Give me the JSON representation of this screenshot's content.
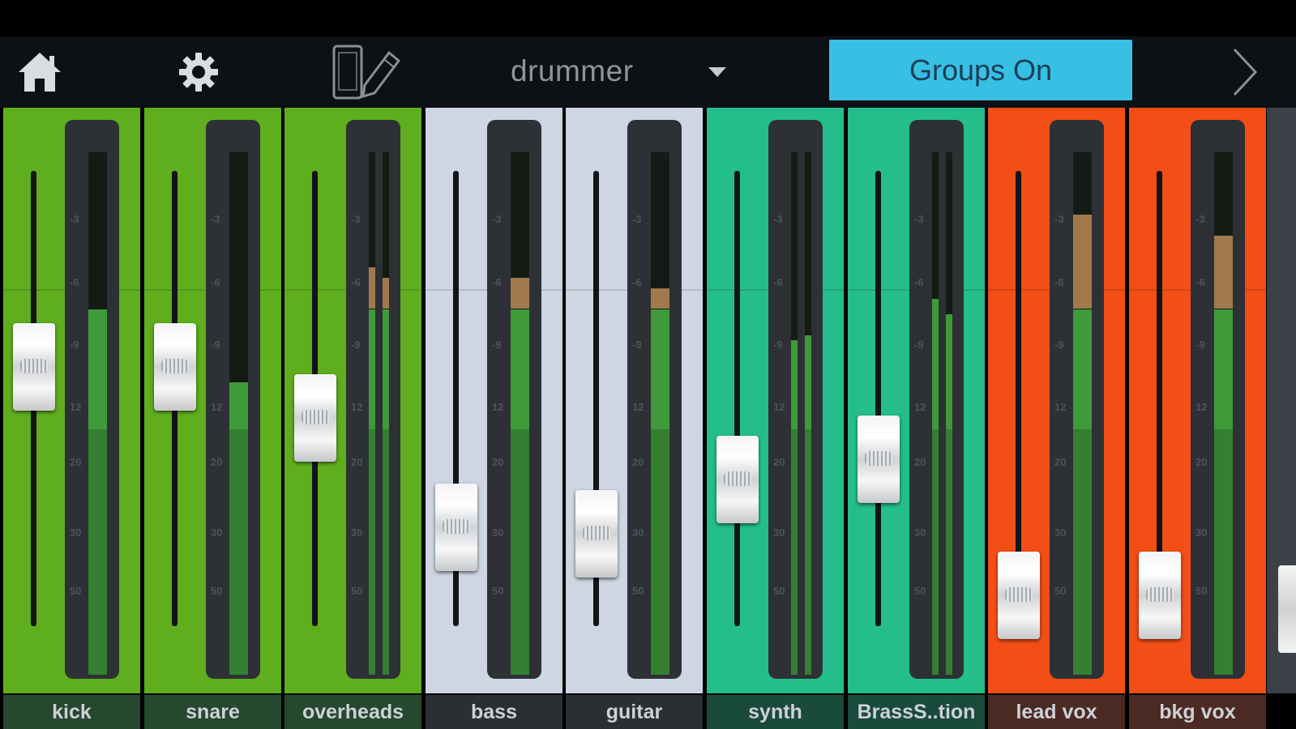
{
  "toolbar": {
    "home_icon": "home-icon",
    "settings_icon": "gear-icon",
    "device_icon": "device-pencil-icon",
    "preset_name": "drummer",
    "groups_label": "Groups On",
    "next_icon": "chevron-right-icon",
    "groups_color": "#38bfe4"
  },
  "scale_labels": [
    "-3",
    "-6",
    "-9",
    "12",
    "20",
    "30",
    "50"
  ],
  "channels": [
    {
      "name": "kick",
      "color": "#5fae1e",
      "fader_pos": 0.31,
      "meter_type": "mono",
      "levels": [
        0.7
      ],
      "peaks": [
        0.7
      ]
    },
    {
      "name": "snare",
      "color": "#5fae1e",
      "fader_pos": 0.31,
      "meter_type": "mono",
      "levels": [
        0.56
      ],
      "peaks": [
        0.56
      ]
    },
    {
      "name": "overheads",
      "color": "#5fae1e",
      "fader_pos": 0.46,
      "meter_type": "stereo",
      "levels": [
        0.7,
        0.7
      ],
      "peaks": [
        0.78,
        0.76
      ]
    },
    {
      "name": "bass",
      "color": "#cdd6e2",
      "fader_pos": 0.78,
      "meter_type": "mono",
      "levels": [
        0.7
      ],
      "peaks": [
        0.76
      ]
    },
    {
      "name": "guitar",
      "color": "#cdd6e2",
      "fader_pos": 0.8,
      "meter_type": "mono",
      "levels": [
        0.7
      ],
      "peaks": [
        0.74
      ]
    },
    {
      "name": "synth",
      "color": "#24be8a",
      "fader_pos": 0.64,
      "meter_type": "stereo",
      "levels": [
        0.64,
        0.65
      ],
      "peaks": [
        0.64,
        0.65
      ]
    },
    {
      "name": "BrassS..tion",
      "color": "#24be8a",
      "fader_pos": 0.58,
      "meter_type": "stereo",
      "levels": [
        0.72,
        0.69
      ],
      "peaks": [
        0.72,
        0.69
      ]
    },
    {
      "name": "lead vox",
      "color": "#f24e15",
      "fader_pos": 0.98,
      "meter_type": "mono",
      "levels": [
        0.7
      ],
      "peaks": [
        0.88
      ]
    },
    {
      "name": "bkg vox",
      "color": "#f24e15",
      "fader_pos": 0.98,
      "meter_type": "mono",
      "levels": [
        0.7
      ],
      "peaks": [
        0.84
      ]
    }
  ]
}
